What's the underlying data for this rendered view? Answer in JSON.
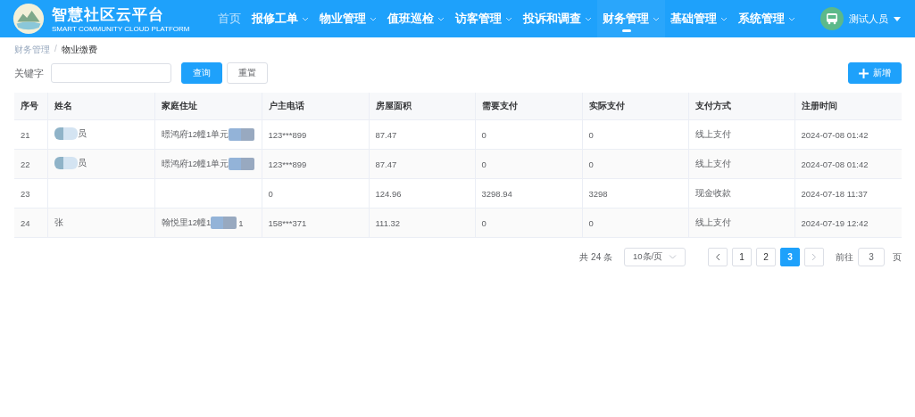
{
  "header": {
    "title": "智慧社区云平台",
    "subtitle": "SMART COMMUNITY CLOUD PLATFORM",
    "nav": [
      {
        "label": "首页",
        "selected": false,
        "has_menu": false
      },
      {
        "label": "报修工单",
        "selected": false,
        "has_menu": true
      },
      {
        "label": "物业管理",
        "selected": false,
        "has_menu": true
      },
      {
        "label": "值班巡检",
        "selected": false,
        "has_menu": true
      },
      {
        "label": "访客管理",
        "selected": false,
        "has_menu": true
      },
      {
        "label": "投诉和调查",
        "selected": false,
        "has_menu": true
      },
      {
        "label": "财务管理",
        "selected": true,
        "has_menu": true
      },
      {
        "label": "基础管理",
        "selected": false,
        "has_menu": true
      },
      {
        "label": "系统管理",
        "selected": false,
        "has_menu": true
      }
    ],
    "user": "测试人员"
  },
  "breadcrumb": [
    "财务管理",
    "物业缴费"
  ],
  "breadcrumb_separator": "/",
  "search": {
    "label": "关键字",
    "query_button": "查询",
    "reset_button": "重置",
    "add_button": "新增"
  },
  "table": {
    "columns": [
      "序号",
      "姓名",
      "家庭住址",
      "户主电话",
      "房屋面积",
      "需要支付",
      "实际支付",
      "支付方式",
      "注册时间"
    ],
    "rows": [
      {
        "index": "21",
        "name": "员",
        "name_redacted": true,
        "address": "暻鸿府12幢1单元",
        "address_redacted": true,
        "address_tail": "",
        "phone": "123***899",
        "area": "87.47",
        "due": "0",
        "paid": "0",
        "method": "线上支付",
        "time": "2024-07-08 01:42"
      },
      {
        "index": "22",
        "name": "员",
        "name_redacted": true,
        "address": "暻鸿府12幢1单元",
        "address_redacted": true,
        "address_tail": "",
        "phone": "123***899",
        "area": "87.47",
        "due": "0",
        "paid": "0",
        "method": "线上支付",
        "time": "2024-07-08 01:42"
      },
      {
        "index": "23",
        "name": "",
        "name_redacted": false,
        "address": "",
        "address_redacted": false,
        "address_tail": "",
        "phone": "0",
        "area": "124.96",
        "due": "3298.94",
        "paid": "3298",
        "method": "现金收款",
        "time": "2024-07-18 11:37"
      },
      {
        "index": "24",
        "name": "张",
        "name_redacted": false,
        "address": "翰悦里12幢1",
        "address_redacted": true,
        "address_tail": "1",
        "phone": "158***371",
        "area": "111.32",
        "due": "0",
        "paid": "0",
        "method": "线上支付",
        "time": "2024-07-19 12:42"
      }
    ]
  },
  "pagination": {
    "total": "共 24 条",
    "page_size": "10条/页",
    "pages": [
      {
        "label": "1",
        "selected": false
      },
      {
        "label": "2",
        "selected": false
      },
      {
        "label": "3",
        "selected": true
      }
    ],
    "goto_label": "前往",
    "goto_value": "3",
    "goto_suffix": "页"
  }
}
